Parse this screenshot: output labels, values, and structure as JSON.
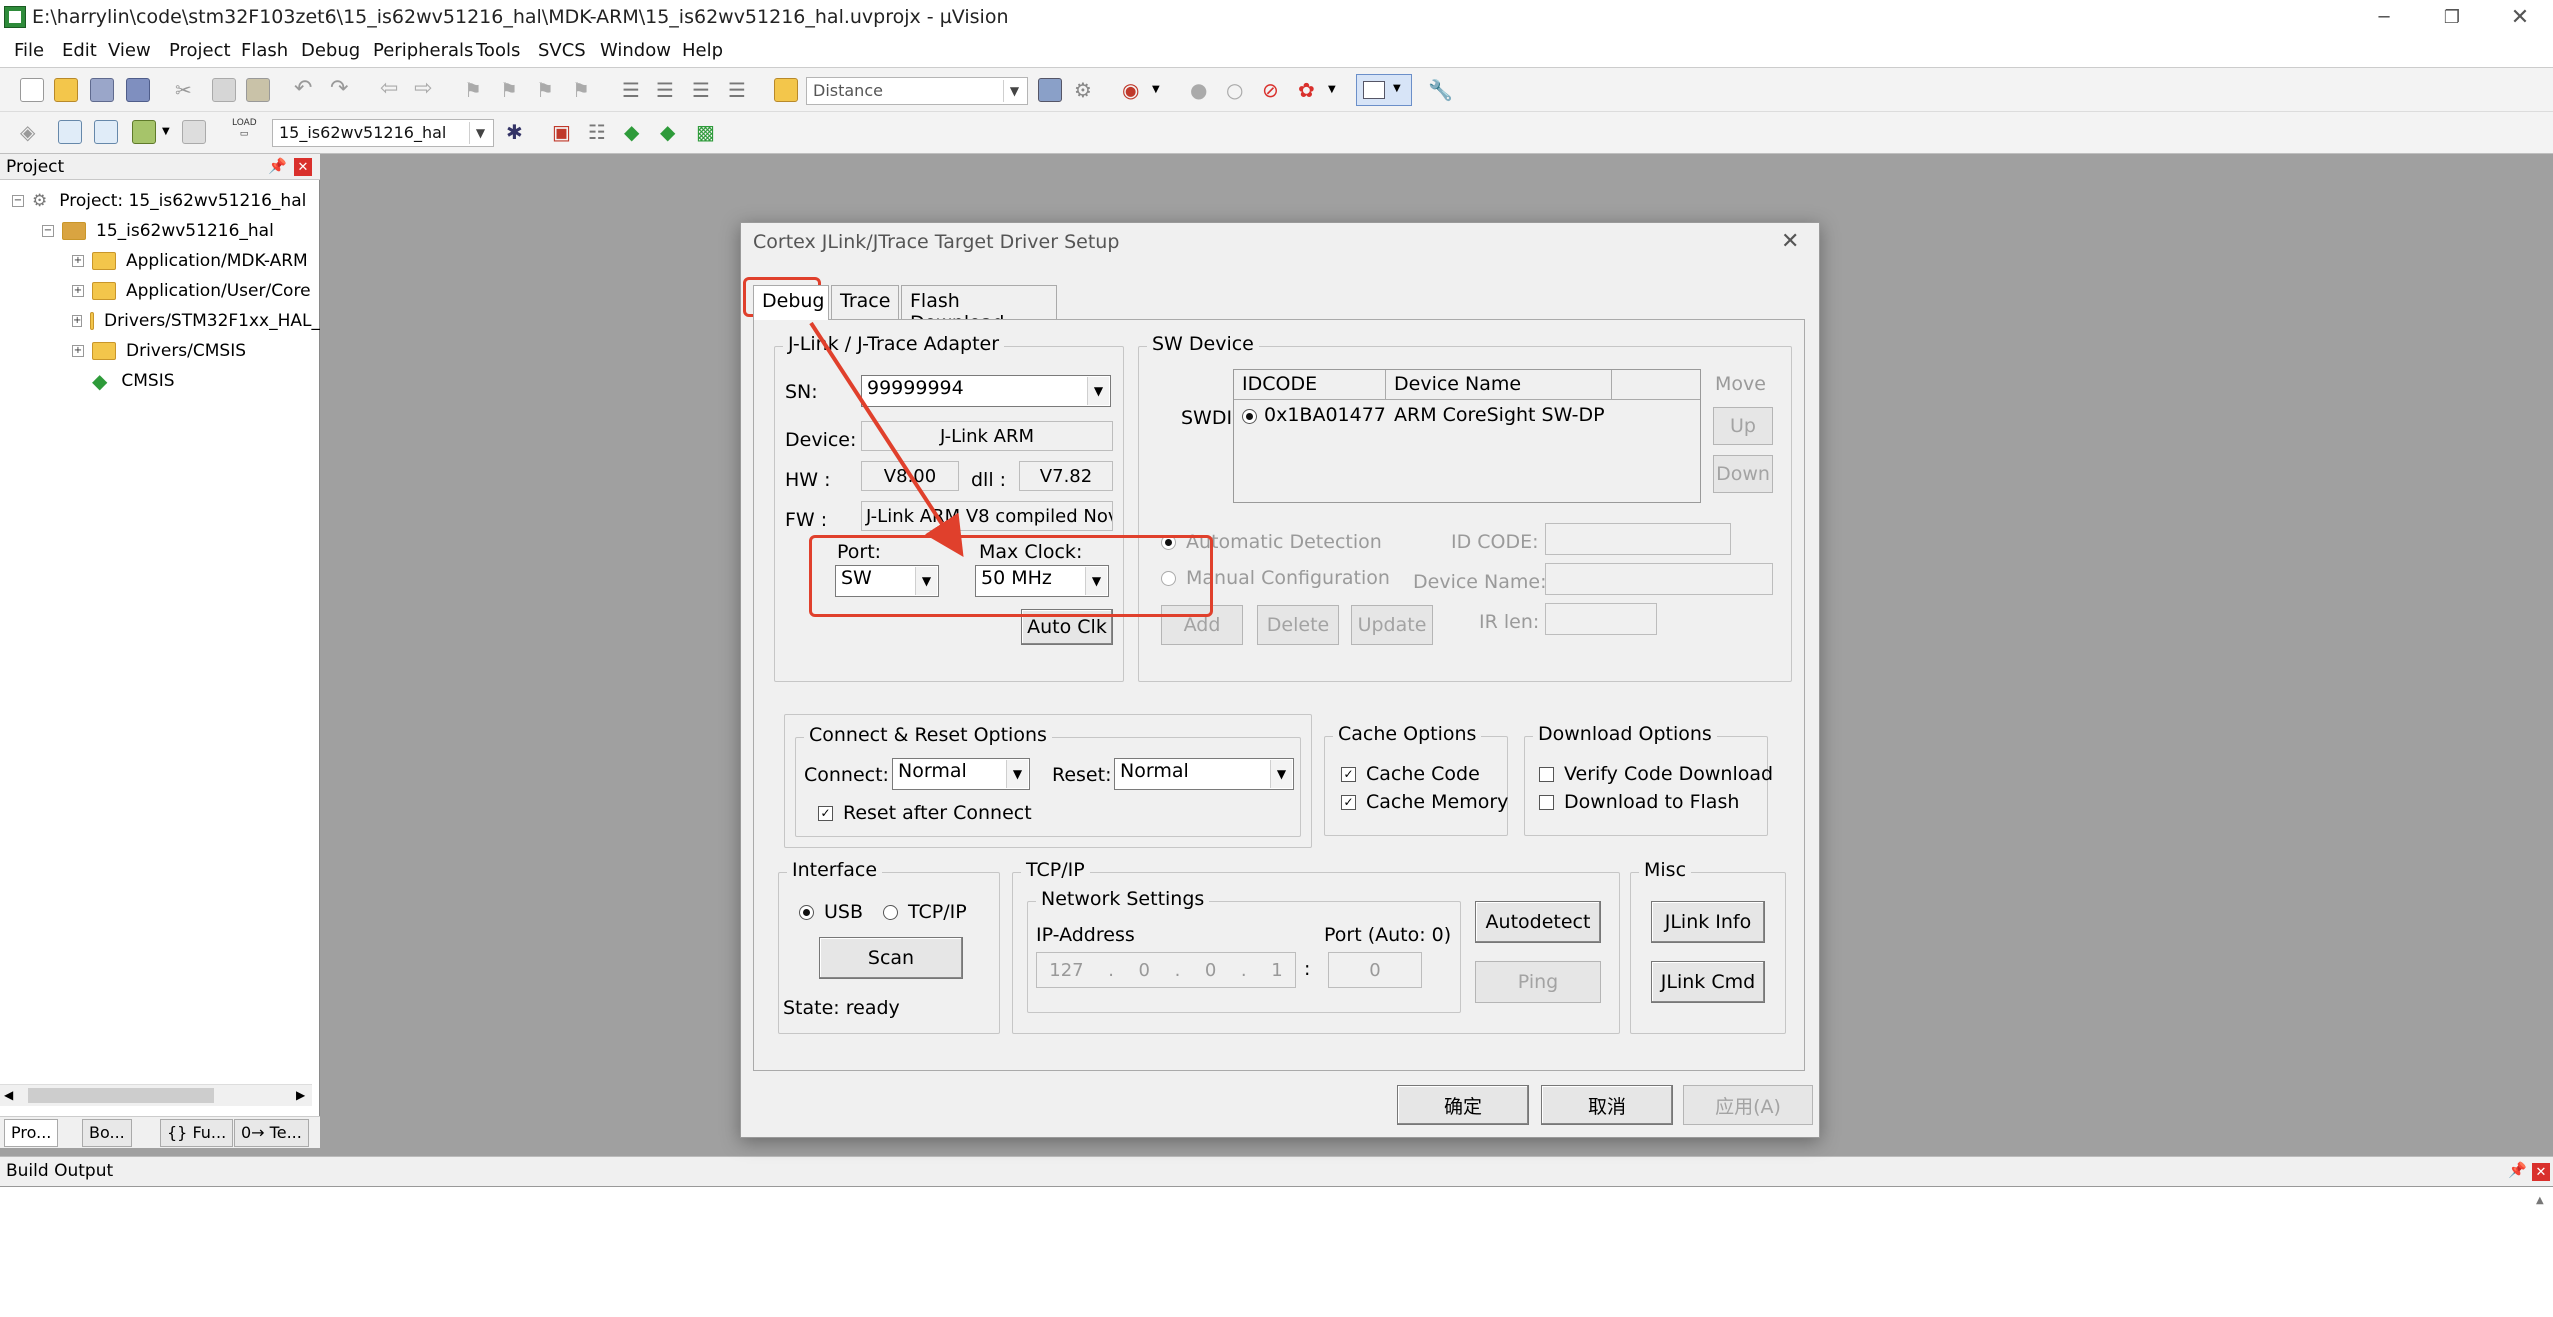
{
  "window": {
    "title": "E:\\harrylin\\code\\stm32F103zet6\\15_is62wv51216_hal\\MDK-ARM\\15_is62wv51216_hal.uvprojx - µVision"
  },
  "menu": [
    "File",
    "Edit",
    "View",
    "Project",
    "Flash",
    "Debug",
    "Peripherals",
    "Tools",
    "SVCS",
    "Window",
    "Help"
  ],
  "toolbar": {
    "find_combo": "Distance",
    "target_combo": "15_is62wv51216_hal"
  },
  "project": {
    "panel_title": "Project",
    "root": "Project: 15_is62wv51216_hal",
    "target": "15_is62wv51216_hal",
    "groups": [
      "Application/MDK-ARM",
      "Application/User/Core",
      "Drivers/STM32F1xx_HAL_",
      "Drivers/CMSIS"
    ],
    "cmsis": "CMSIS",
    "tabs": [
      "Pro...",
      "Bo...",
      "{} Fu...",
      "0→ Te..."
    ]
  },
  "build_output": {
    "title": "Build Output"
  },
  "dialog": {
    "title": "Cortex JLink/JTrace Target Driver Setup",
    "tabs": [
      "Debug",
      "Trace",
      "Flash Download"
    ],
    "adapter": {
      "group": "J-Link / J-Trace Adapter",
      "sn_label": "SN:",
      "sn": "99999994",
      "device_label": "Device:",
      "device": "J-Link ARM",
      "hw_label": "HW :",
      "hw": "V8.00",
      "dll_label": "dll :",
      "dll": "V7.82",
      "fw_label": "FW :",
      "fw": "J-Link ARM V8 compiled Nov",
      "port_label": "Port:",
      "port": "SW",
      "clock_label": "Max Clock:",
      "clock": "50 MHz",
      "auto_clk": "Auto Clk"
    },
    "sw_device": {
      "group": "SW Device",
      "col_idcode": "IDCODE",
      "col_name": "Device Name",
      "row_label": "SWDI",
      "row_idcode": "0x1BA01477",
      "row_name": "ARM CoreSight SW-DP",
      "move": "Move",
      "up": "Up",
      "down": "Down",
      "auto_detect": "Automatic Detection",
      "manual_config": "Manual Configuration",
      "id_code_label": "ID CODE:",
      "device_name_label": "Device Name:",
      "ir_len_label": "IR len:",
      "add": "Add",
      "delete": "Delete",
      "update": "Update"
    },
    "connect_reset": {
      "group": "Connect & Reset Options",
      "connect_label": "Connect:",
      "connect": "Normal",
      "reset_label": "Reset:",
      "reset": "Normal",
      "reset_after": "Reset after Connect"
    },
    "cache": {
      "group": "Cache Options",
      "code": "Cache Code",
      "memory": "Cache Memory"
    },
    "download": {
      "group": "Download Options",
      "verify": "Verify Code Download",
      "to_flash": "Download to Flash"
    },
    "interface": {
      "group": "Interface",
      "usb": "USB",
      "tcpip": "TCP/IP",
      "scan": "Scan",
      "state": "State: ready"
    },
    "tcpip": {
      "group": "TCP/IP",
      "network": "Network Settings",
      "ip_label": "IP-Address",
      "ip": [
        "127",
        "0",
        "0",
        "1"
      ],
      "port_label": "Port (Auto: 0)",
      "port": "0",
      "autodetect": "Autodetect",
      "ping": "Ping"
    },
    "misc": {
      "group": "Misc",
      "jlink_info": "JLink Info",
      "jlink_cmd": "JLink Cmd"
    },
    "buttons": {
      "ok": "确定",
      "cancel": "取消",
      "apply": "应用(A)"
    }
  },
  "colors": {
    "annotation": "#e0402c",
    "workspace": "#a0a0a0",
    "dialog_bg": "#f0f0f0"
  }
}
